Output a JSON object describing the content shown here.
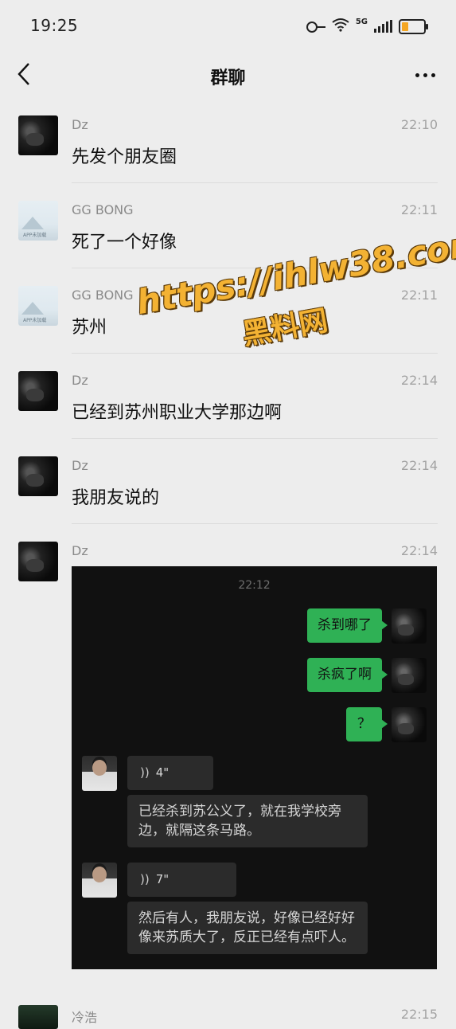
{
  "status_bar": {
    "time": "19:25",
    "network": "5G"
  },
  "header": {
    "title": "群聊"
  },
  "messages": [
    {
      "sender": "Dz",
      "time": "22:10",
      "text": "先发个朋友圈",
      "avatar": "dark-cat"
    },
    {
      "sender": "GG BONG",
      "time": "22:11",
      "text": "死了一个好像",
      "avatar": "placeholder"
    },
    {
      "sender": "GG BONG",
      "time": "22:11",
      "text": "苏州",
      "avatar": "placeholder"
    },
    {
      "sender": "Dz",
      "time": "22:14",
      "text": "已经到苏州职业大学那边啊",
      "avatar": "dark-cat"
    },
    {
      "sender": "Dz",
      "time": "22:14",
      "text": "我朋友说的",
      "avatar": "dark-cat"
    },
    {
      "sender": "Dz",
      "time": "22:14",
      "avatar": "dark-cat"
    },
    {
      "sender": "冷浩",
      "time": "22:15",
      "avatar": "dark-green"
    }
  ],
  "screenshot": {
    "time": "22:12",
    "outgoing": [
      "杀到哪了",
      "杀疯了啊",
      "？"
    ],
    "incoming": [
      {
        "voice": "4\"",
        "transcript": "已经杀到苏公义了，就在我学校旁边，就隔这条马路。"
      },
      {
        "voice": "7\"",
        "transcript": "然后有人，我朋友说，好像已经好好像来苏质大了，反正已经有点吓人。"
      }
    ]
  },
  "watermark": {
    "line1": "https://ihlw38.com",
    "line2": "黑料网"
  },
  "colors": {
    "background": "#ededed",
    "green_bubble": "#2fb155",
    "watermark": "#f3b233"
  }
}
